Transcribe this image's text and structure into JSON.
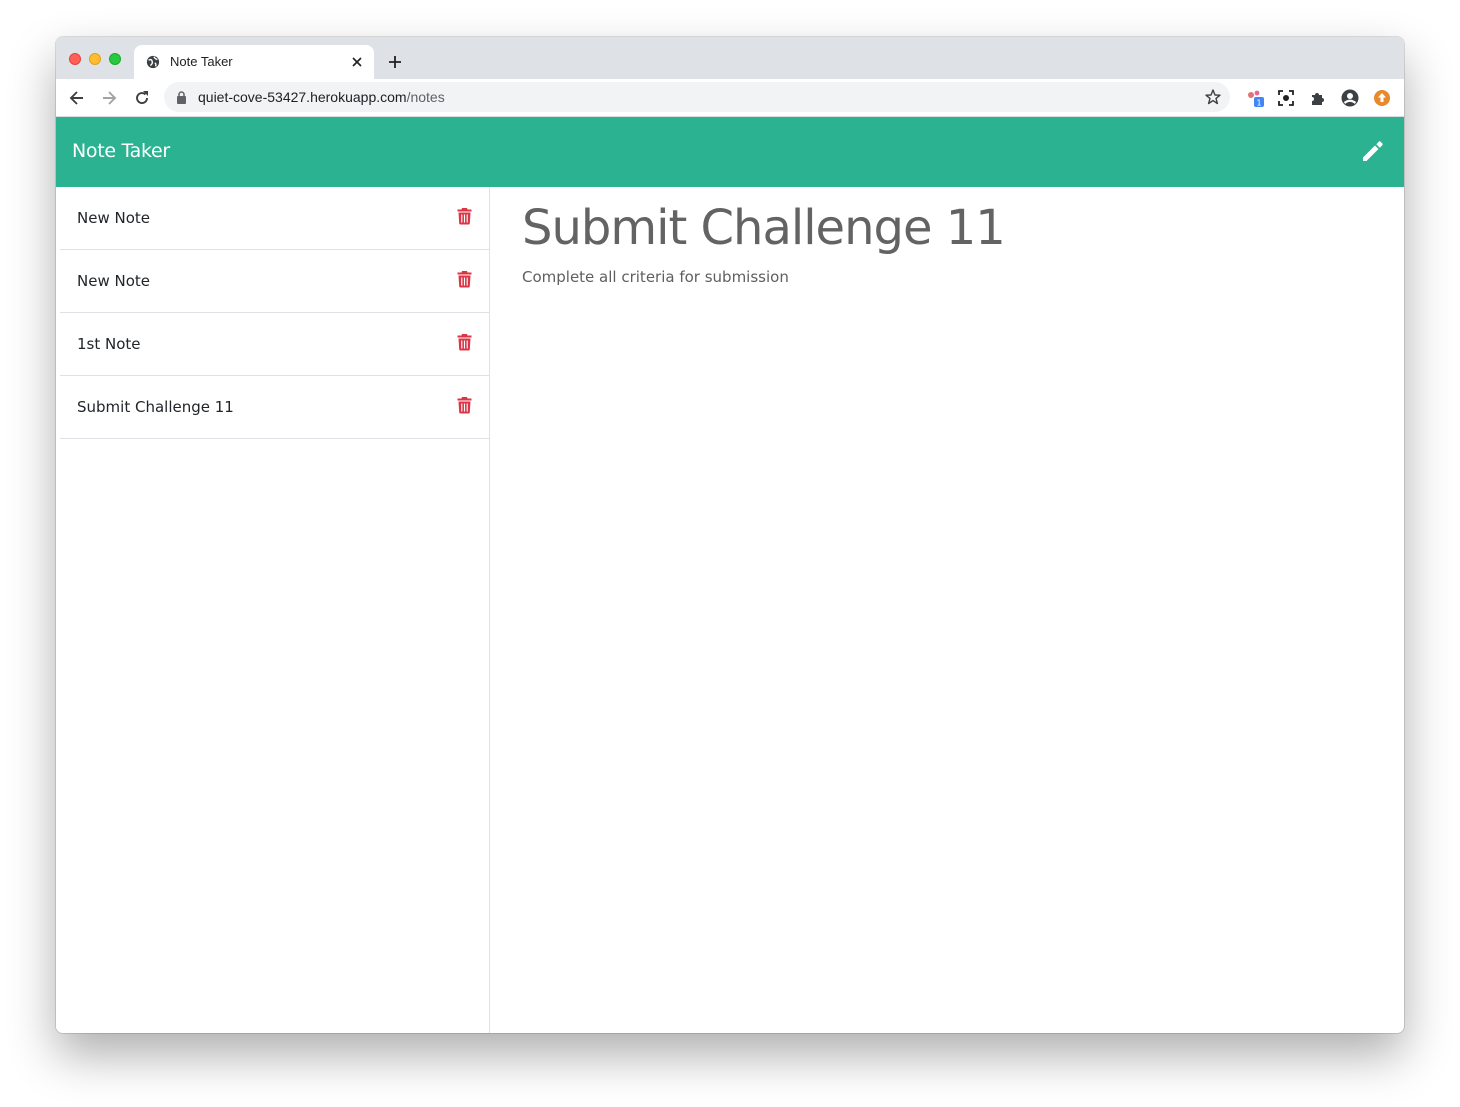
{
  "browser": {
    "tab_title": "Note Taker",
    "url_host": "quiet-cove-53427.herokuapp.com",
    "url_path": "/notes",
    "extension_badge": "1"
  },
  "app": {
    "brand": "Note Taker",
    "accent_color": "#2bb290",
    "delete_color": "#dc3545",
    "notes": [
      {
        "title": "New Note"
      },
      {
        "title": "New Note"
      },
      {
        "title": "1st Note"
      },
      {
        "title": "Submit Challenge 11"
      }
    ],
    "active_note": {
      "title": "Submit Challenge 11",
      "text": "Complete all criteria for submission"
    }
  }
}
